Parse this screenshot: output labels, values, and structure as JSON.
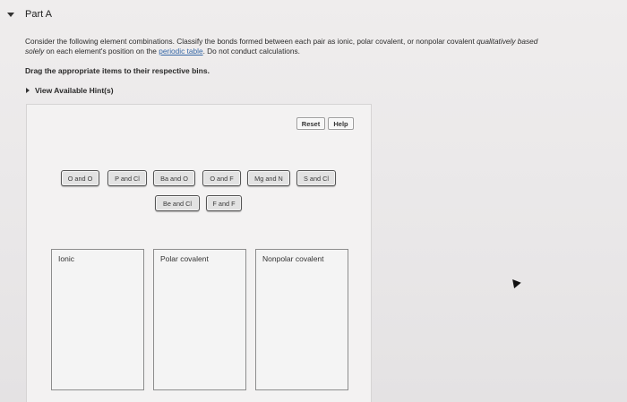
{
  "part": {
    "title": "Part A"
  },
  "question": {
    "line1": "Consider the following element combinations. Classify the bonds formed between each pair as ionic, polar covalent, or nonpolar covalent",
    "line1_italic": "qualitatively based",
    "line2_italic": "solely",
    "line2_pre": "on each element's position on the",
    "link": "periodic table",
    "line2_post": ". Do not conduct calculations."
  },
  "instruction": "Drag the appropriate items to their respective bins.",
  "hints": {
    "label": "View Available Hint(s)"
  },
  "toolbar": {
    "reset": "Reset",
    "help": "Help"
  },
  "items": [
    "O and O",
    "P and Cl",
    "Ba and O",
    "O and F",
    "Mg and N",
    "S and Cl",
    "Be and Cl",
    "F and F"
  ],
  "bins": [
    "Ionic",
    "Polar covalent",
    "Nonpolar covalent"
  ],
  "colors": {
    "link": "#3466a5",
    "item_background": "#e2e2e2",
    "item_border": "#555555"
  }
}
